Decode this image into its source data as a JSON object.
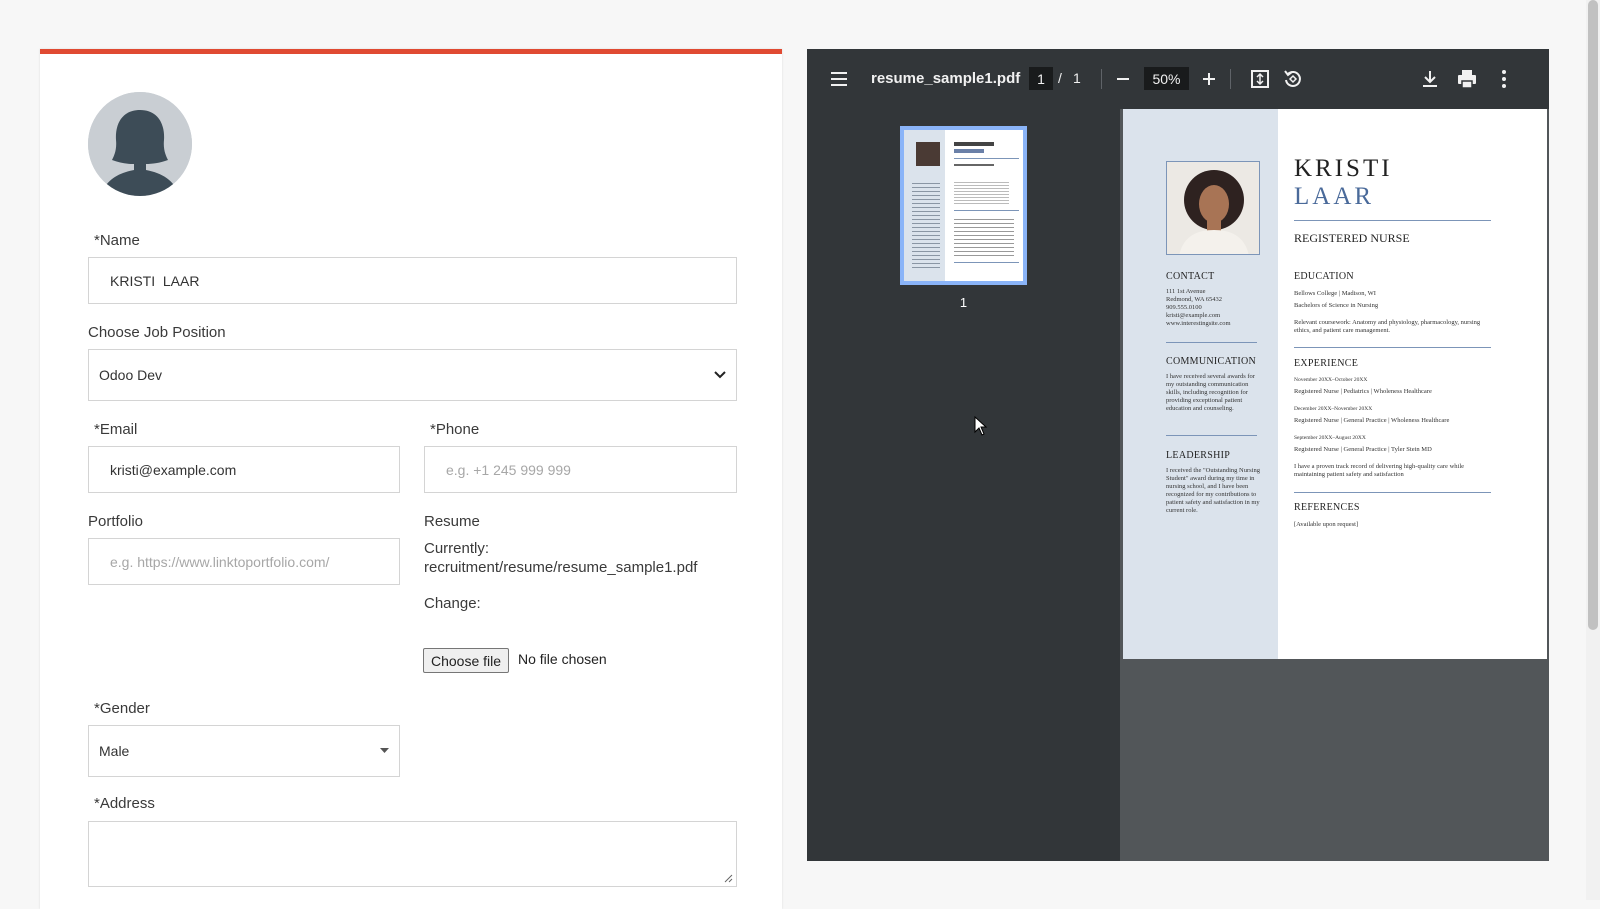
{
  "form": {
    "name_label": "*Name",
    "name_value": "KRISTI  LAAR",
    "job_label": "Choose Job Position",
    "job_value": "Odoo Dev",
    "email_label": "*Email",
    "email_value": "kristi@example.com",
    "phone_label": "*Phone",
    "phone_placeholder": "e.g. +1 245 999 999",
    "portfolio_label": "Portfolio",
    "portfolio_placeholder": "e.g. https://www.linktoportfolio.com/",
    "resume_label": "Resume",
    "currently_label": "Currently:",
    "current_file": "recruitment/resume/resume_sample1.pdf",
    "change_label": "Change:",
    "choose_file_label": "Choose file",
    "no_file_text": "No file chosen",
    "gender_label": "*Gender",
    "gender_value": "Male",
    "address_label": "*Address",
    "accent_color": "#e04a32"
  },
  "viewer": {
    "file_name": "resume_sample1.pdf",
    "current_page": "1",
    "page_sep": "/",
    "total_pages": "1",
    "zoom": "50%",
    "thumb_page_num": "1",
    "icons": [
      "menu-icon",
      "zoom-out-icon",
      "zoom-in-icon",
      "fit-page-icon",
      "rotate-icon",
      "download-icon",
      "print-icon",
      "more-icon"
    ]
  },
  "resume": {
    "first_name": "KRISTI",
    "last_name": "LAAR",
    "title": "REGISTERED NURSE",
    "contact_heading": "CONTACT",
    "contact_lines": [
      "111 1st Avenue",
      "Redmond, WA 65432",
      "909.555.0100",
      "kristi@example.com",
      "www.interestingsite.com"
    ],
    "communication_heading": "COMMUNICATION",
    "communication_text": "I have received several awards for my outstanding communication skills, including recognition for providing exceptional patient education and counseling.",
    "leadership_heading": "LEADERSHIP",
    "leadership_text": "I received the \"Outstanding Nursing Student\" award during my time in nursing school, and I have been recognized for my contributions to patient safety and satisfaction in my current role.",
    "education_heading": "EDUCATION",
    "education_school": "Bellows College | Madison, WI",
    "education_degree": "Bachelors of Science in Nursing",
    "education_coursework": "Relevant coursework: Anatomy and physiology, pharmacology, nursing ethics, and patient care management.",
    "experience_heading": "EXPERIENCE",
    "jobs": [
      {
        "dates": "November 20XX–October 20XX",
        "role": "Registered Nurse | Pediatrics | Wholeness Healthcare"
      },
      {
        "dates": "December 20XX–November 20XX",
        "role": "Registered Nurse | General Practice | Wholeness Healthcare"
      },
      {
        "dates": "September 20XX–August 20XX",
        "role": "Registered Nurse | General Practice | Tyler Stein MD"
      }
    ],
    "experience_summary": "I have a proven track record of delivering high-quality care while maintaining patient safety and satisfaction",
    "references_heading": "REFERENCES",
    "references_text": "[Available upon request]"
  }
}
